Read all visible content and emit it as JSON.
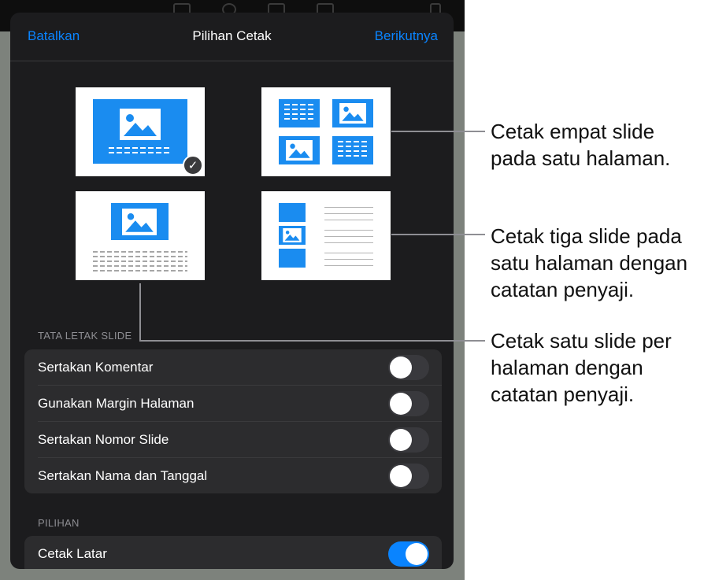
{
  "nav": {
    "cancel": "Batalkan",
    "title": "Pilihan Cetak",
    "next": "Berikutnya"
  },
  "layouts": [
    {
      "id": "single",
      "selected": true
    },
    {
      "id": "four",
      "selected": false
    },
    {
      "id": "notes-one",
      "selected": false
    },
    {
      "id": "notes-three",
      "selected": false
    }
  ],
  "section_layout": "TATA LETAK SLIDE",
  "layout_rows": [
    {
      "label": "Sertakan Komentar",
      "on": false
    },
    {
      "label": "Gunakan Margin Halaman",
      "on": false
    },
    {
      "label": "Sertakan Nomor Slide",
      "on": false
    },
    {
      "label": "Sertakan Nama dan Tanggal",
      "on": false
    }
  ],
  "section_options": "PILIHAN",
  "option_rows": [
    {
      "label": "Cetak Latar",
      "on": true
    }
  ],
  "callouts": {
    "four": [
      "Cetak empat slide",
      "pada satu halaman."
    ],
    "three": [
      "Cetak tiga slide pada",
      "satu halaman dengan",
      "catatan penyaji."
    ],
    "single": [
      "Cetak satu slide per",
      "halaman dengan",
      "catatan penyaji."
    ]
  },
  "colors": {
    "accent": "#0a84ff",
    "slide_blue": "#1a8cf0",
    "sheet_bg": "#1c1c1e",
    "row_bg": "#2c2c2e"
  },
  "icons": {
    "checkmark": "checkmark-icon",
    "image": "image-placeholder-icon"
  }
}
